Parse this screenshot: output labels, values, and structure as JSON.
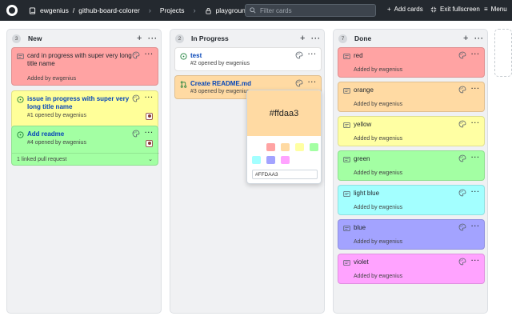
{
  "header": {
    "owner": "ewgenius",
    "repo": "github-board-colorer",
    "section": "Projects",
    "project": "playground",
    "search_placeholder": "Filter cards",
    "add_cards": "Add cards",
    "exit_fullscreen": "Exit fullscreen",
    "menu": "Menu"
  },
  "columns": [
    {
      "count": "3",
      "name": "New",
      "cards": [
        {
          "title": "card in progress with super very long title name",
          "meta": "Added by ewgenius",
          "color": "#ffa3a3"
        },
        {
          "title": "issue in progress with super very long title name",
          "meta": "#1 opened by ewgenius",
          "color": "#ffff99"
        },
        {
          "title": "Add readme",
          "meta": "#4 opened by ewgenius",
          "linked": "1 linked pull request",
          "color": "#a3ffa3"
        }
      ]
    },
    {
      "count": "2",
      "name": "In Progress",
      "cards": [
        {
          "title": "test",
          "meta": "#2 opened by ewgenius",
          "color": "#ffffff"
        },
        {
          "title": "Create README.md",
          "meta": "#3 opened by ewgenius",
          "color": "#ffdaa3"
        }
      ]
    },
    {
      "count": "7",
      "name": "Done",
      "cards": [
        {
          "title": "red",
          "meta": "Added by ewgenius",
          "color": "#ffa3a3"
        },
        {
          "title": "orange",
          "meta": "Added by ewgenius",
          "color": "#ffdaa3"
        },
        {
          "title": "yellow",
          "meta": "Added by ewgenius",
          "color": "#ffffa3"
        },
        {
          "title": "green",
          "meta": "Added by ewgenius",
          "color": "#a3ffa3"
        },
        {
          "title": "light blue",
          "meta": "Added by ewgenius",
          "color": "#a3ffff"
        },
        {
          "title": "blue",
          "meta": "Added by ewgenius",
          "color": "#a3a3ff"
        },
        {
          "title": "violet",
          "meta": "Added by ewgenius",
          "color": "#ffa3ff"
        }
      ]
    }
  ],
  "picker": {
    "preview_label": "#ffdaa3",
    "preview_color": "#ffdaa3",
    "hex_value": "#FFDAA3",
    "swatches": [
      "#ffffff",
      "#ffa3a3",
      "#ffdaa3",
      "#ffffa3",
      "#a3ffa3",
      "#a3ffff",
      "#a3a3ff",
      "#ffa3ff"
    ]
  }
}
